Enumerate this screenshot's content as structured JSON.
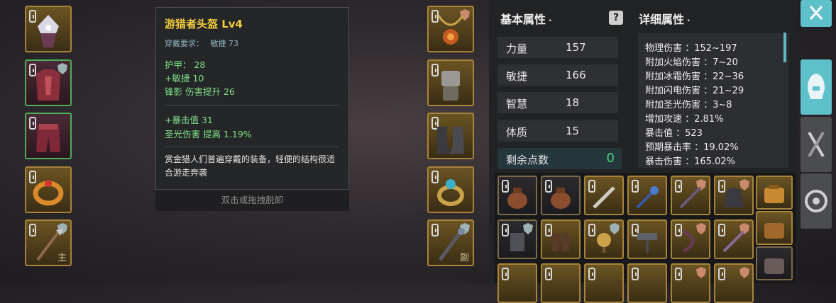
{
  "tooltip": {
    "title": "游猎者头盔 Lv4",
    "requirement_label": "穿戴要求：",
    "requirement_value": "敏捷 73",
    "base_stats": [
      "护甲： 28",
      "+敏捷 10",
      "锋影 伤害提升 26"
    ],
    "extra_stats": [
      "+暴击值 31",
      "圣光伤害 提高 1.19%"
    ],
    "description": "赏金猎人们普遍穿戴的装备，轻便的结构很适合游走奔袭",
    "hint": "双击或拖拽脱卸"
  },
  "equipment": {
    "left": [
      {
        "name": "helmet-slot",
        "tag": ""
      },
      {
        "name": "armor-slot",
        "tag": ""
      },
      {
        "name": "legs-slot",
        "tag": ""
      },
      {
        "name": "ring-slot",
        "tag": ""
      },
      {
        "name": "main-weapon-slot",
        "tag": "主"
      }
    ],
    "right": [
      {
        "name": "necklace-slot",
        "tag": ""
      },
      {
        "name": "gloves-slot",
        "tag": ""
      },
      {
        "name": "boots-slot",
        "tag": ""
      },
      {
        "name": "ring2-slot",
        "tag": ""
      },
      {
        "name": "offhand-weapon-slot",
        "tag": "副"
      }
    ]
  },
  "basic": {
    "title": "基本属性",
    "stats": [
      {
        "label": "力量",
        "value": "157"
      },
      {
        "label": "敏捷",
        "value": "166"
      },
      {
        "label": "智慧",
        "value": "18"
      },
      {
        "label": "体质",
        "value": "15"
      }
    ],
    "remaining_label": "剩余点数",
    "remaining_value": "0"
  },
  "detail": {
    "title": "详细属性",
    "rows": [
      "物理伤害 ：152~197",
      "附加火焰伤害 ：7~20",
      "附加冰霜伤害 ：22~36",
      "附加闪电伤害 ：21~29",
      "附加圣光伤害 ：3~8",
      "增加攻速 ：2.81%",
      "暴击值 ：523",
      "预期暴击率 ：19.02%",
      "暴击伤害 ：165.02%"
    ]
  },
  "colors": {
    "accent": "#5fb7c3",
    "gold": "#a7843a",
    "green": "#4fae58",
    "title_yellow": "#f1cc3e",
    "stat_green": "#7ee08a"
  },
  "side_buttons": [
    "close-icon",
    "helmet-tab-icon",
    "swords-tab-icon",
    "settings-tab-icon"
  ]
}
